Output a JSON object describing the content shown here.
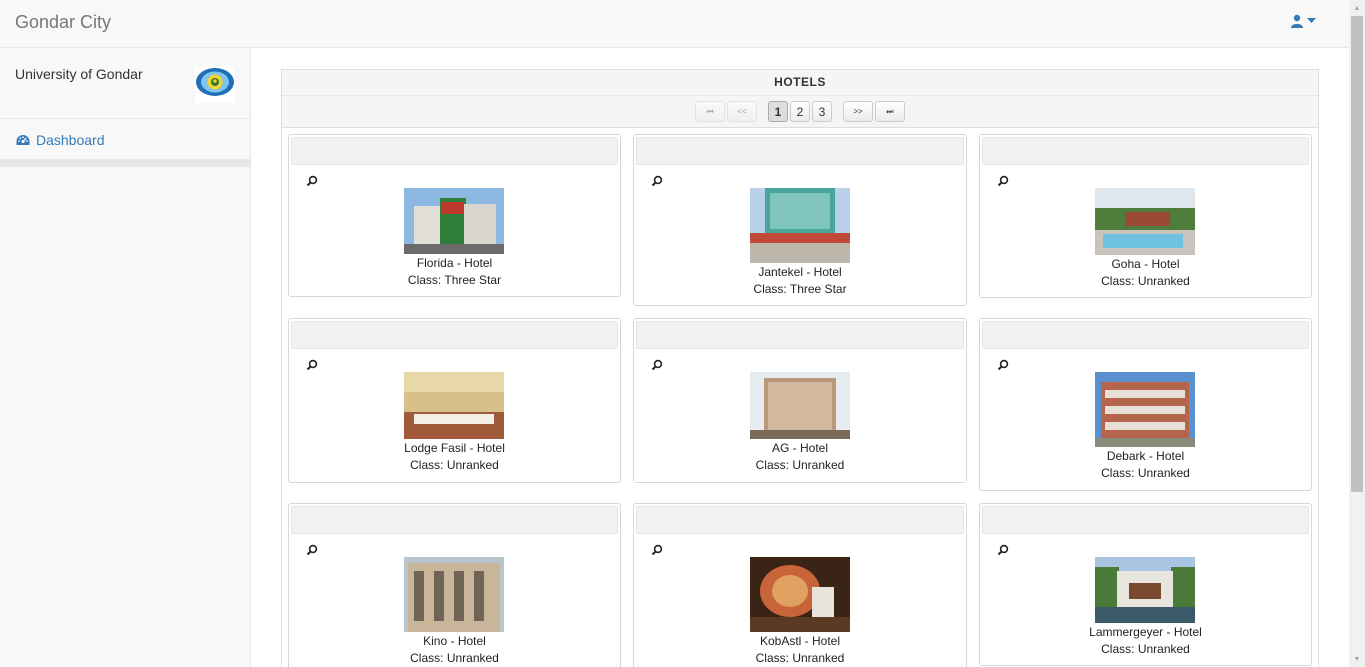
{
  "app": {
    "title": "Gondar City"
  },
  "sidebar": {
    "org_name": "University of Gondar",
    "dashboard_label": "Dashboard"
  },
  "panel": {
    "title": "HOTELS"
  },
  "pager": {
    "first": "⏮",
    "prev": "<<",
    "next": ">>",
    "last": "⏭",
    "pages": [
      "1",
      "2",
      "3"
    ],
    "current": "1"
  },
  "hotels": [
    {
      "name": "Florida - Hotel",
      "class": "Class: Three Star"
    },
    {
      "name": "Jantekel - Hotel",
      "class": "Class: Three Star"
    },
    {
      "name": "Goha - Hotel",
      "class": "Class: Unranked"
    },
    {
      "name": "Lodge Fasil - Hotel",
      "class": "Class: Unranked"
    },
    {
      "name": "AG - Hotel",
      "class": "Class: Unranked"
    },
    {
      "name": "Debark - Hotel",
      "class": "Class: Unranked"
    },
    {
      "name": "Kino - Hotel",
      "class": "Class: Unranked"
    },
    {
      "name": "KobAstl - Hotel",
      "class": "Class: Unranked"
    },
    {
      "name": "Lammergeyer - Hotel",
      "class": "Class: Unranked"
    }
  ],
  "colors": {
    "link": "#337ab7",
    "navbar": "#f8f8f8"
  },
  "icons": {
    "user": "user-icon",
    "dashboard": "dashboard-icon",
    "zoom": "magnifier-icon"
  }
}
